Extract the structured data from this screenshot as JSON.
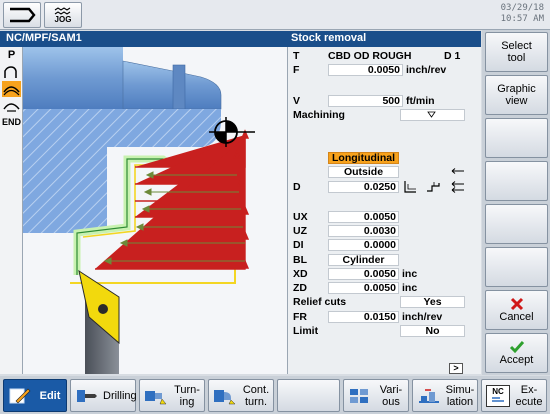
{
  "status": {
    "date": "03/29/18",
    "time": "10:57 AM",
    "jog_label": "JOG"
  },
  "header": {
    "path": "NC/MPF/SAM1",
    "mode_title": "Stock removal"
  },
  "left_toolbar": {
    "label_p": "P",
    "label_end": "END"
  },
  "params": {
    "T": {
      "label": "T",
      "tool": "CBD OD ROUGH",
      "d": "D 1"
    },
    "F": {
      "label": "F",
      "value": "0.0050",
      "unit": "inch/rev"
    },
    "V": {
      "label": "V",
      "value": "500",
      "unit": "ft/min"
    },
    "machining": {
      "label": "Machining",
      "value": ""
    },
    "direction": "Longitudinal",
    "position": "Outside",
    "D": {
      "label": "D",
      "value": "0.0250"
    },
    "UX": {
      "label": "UX",
      "value": "0.0050"
    },
    "UZ": {
      "label": "UZ",
      "value": "0.0030"
    },
    "DI": {
      "label": "DI",
      "value": "0.0000"
    },
    "BL": {
      "label": "BL",
      "value": "Cylinder"
    },
    "XD": {
      "label": "XD",
      "value": "0.0050",
      "unit": "inc"
    },
    "ZD": {
      "label": "ZD",
      "value": "0.0050",
      "unit": "inc"
    },
    "relief": {
      "label": "Relief cuts",
      "value": "Yes"
    },
    "FR": {
      "label": "FR",
      "value": "0.0150",
      "unit": "inch/rev"
    },
    "limit": {
      "label": "Limit",
      "value": "No"
    },
    "scroll_more": ">"
  },
  "right_softkeys": {
    "select_tool": "Select tool",
    "graphic_view": "Graphic view",
    "cancel": "Cancel",
    "accept": "Accept"
  },
  "bottom_softkeys": {
    "edit": "Edit",
    "drilling": "Drilling",
    "turning_1": "Turn-",
    "turning_2": "ing",
    "contour_1": "Cont.",
    "contour_2": "turn.",
    "various_1": "Vari-",
    "various_2": "ous",
    "simulation_1": "Simu-",
    "simulation_2": "lation",
    "execute_1": "Ex-",
    "execute_2": "ecute",
    "execute_icon_text": "NC"
  },
  "colors": {
    "title_bar": "#1a4e8a",
    "active_softkey": "#1a5aa6",
    "highlight_orange": "#f7a21c",
    "cancel_red": "#d01818",
    "accept_green": "#2ea02e"
  }
}
